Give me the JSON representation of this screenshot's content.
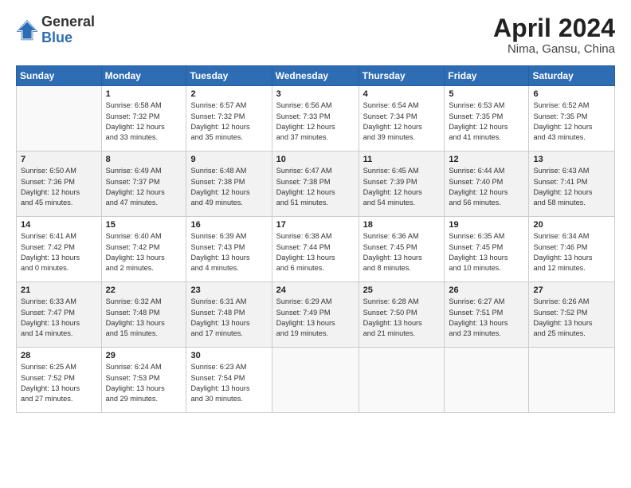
{
  "header": {
    "logo_general": "General",
    "logo_blue": "Blue",
    "month_title": "April 2024",
    "location": "Nima, Gansu, China"
  },
  "weekdays": [
    "Sunday",
    "Monday",
    "Tuesday",
    "Wednesday",
    "Thursday",
    "Friday",
    "Saturday"
  ],
  "weeks": [
    [
      {
        "day": "",
        "info": ""
      },
      {
        "day": "1",
        "info": "Sunrise: 6:58 AM\nSunset: 7:32 PM\nDaylight: 12 hours\nand 33 minutes."
      },
      {
        "day": "2",
        "info": "Sunrise: 6:57 AM\nSunset: 7:32 PM\nDaylight: 12 hours\nand 35 minutes."
      },
      {
        "day": "3",
        "info": "Sunrise: 6:56 AM\nSunset: 7:33 PM\nDaylight: 12 hours\nand 37 minutes."
      },
      {
        "day": "4",
        "info": "Sunrise: 6:54 AM\nSunset: 7:34 PM\nDaylight: 12 hours\nand 39 minutes."
      },
      {
        "day": "5",
        "info": "Sunrise: 6:53 AM\nSunset: 7:35 PM\nDaylight: 12 hours\nand 41 minutes."
      },
      {
        "day": "6",
        "info": "Sunrise: 6:52 AM\nSunset: 7:35 PM\nDaylight: 12 hours\nand 43 minutes."
      }
    ],
    [
      {
        "day": "7",
        "info": "Sunrise: 6:50 AM\nSunset: 7:36 PM\nDaylight: 12 hours\nand 45 minutes."
      },
      {
        "day": "8",
        "info": "Sunrise: 6:49 AM\nSunset: 7:37 PM\nDaylight: 12 hours\nand 47 minutes."
      },
      {
        "day": "9",
        "info": "Sunrise: 6:48 AM\nSunset: 7:38 PM\nDaylight: 12 hours\nand 49 minutes."
      },
      {
        "day": "10",
        "info": "Sunrise: 6:47 AM\nSunset: 7:38 PM\nDaylight: 12 hours\nand 51 minutes."
      },
      {
        "day": "11",
        "info": "Sunrise: 6:45 AM\nSunset: 7:39 PM\nDaylight: 12 hours\nand 54 minutes."
      },
      {
        "day": "12",
        "info": "Sunrise: 6:44 AM\nSunset: 7:40 PM\nDaylight: 12 hours\nand 56 minutes."
      },
      {
        "day": "13",
        "info": "Sunrise: 6:43 AM\nSunset: 7:41 PM\nDaylight: 12 hours\nand 58 minutes."
      }
    ],
    [
      {
        "day": "14",
        "info": "Sunrise: 6:41 AM\nSunset: 7:42 PM\nDaylight: 13 hours\nand 0 minutes."
      },
      {
        "day": "15",
        "info": "Sunrise: 6:40 AM\nSunset: 7:42 PM\nDaylight: 13 hours\nand 2 minutes."
      },
      {
        "day": "16",
        "info": "Sunrise: 6:39 AM\nSunset: 7:43 PM\nDaylight: 13 hours\nand 4 minutes."
      },
      {
        "day": "17",
        "info": "Sunrise: 6:38 AM\nSunset: 7:44 PM\nDaylight: 13 hours\nand 6 minutes."
      },
      {
        "day": "18",
        "info": "Sunrise: 6:36 AM\nSunset: 7:45 PM\nDaylight: 13 hours\nand 8 minutes."
      },
      {
        "day": "19",
        "info": "Sunrise: 6:35 AM\nSunset: 7:45 PM\nDaylight: 13 hours\nand 10 minutes."
      },
      {
        "day": "20",
        "info": "Sunrise: 6:34 AM\nSunset: 7:46 PM\nDaylight: 13 hours\nand 12 minutes."
      }
    ],
    [
      {
        "day": "21",
        "info": "Sunrise: 6:33 AM\nSunset: 7:47 PM\nDaylight: 13 hours\nand 14 minutes."
      },
      {
        "day": "22",
        "info": "Sunrise: 6:32 AM\nSunset: 7:48 PM\nDaylight: 13 hours\nand 15 minutes."
      },
      {
        "day": "23",
        "info": "Sunrise: 6:31 AM\nSunset: 7:48 PM\nDaylight: 13 hours\nand 17 minutes."
      },
      {
        "day": "24",
        "info": "Sunrise: 6:29 AM\nSunset: 7:49 PM\nDaylight: 13 hours\nand 19 minutes."
      },
      {
        "day": "25",
        "info": "Sunrise: 6:28 AM\nSunset: 7:50 PM\nDaylight: 13 hours\nand 21 minutes."
      },
      {
        "day": "26",
        "info": "Sunrise: 6:27 AM\nSunset: 7:51 PM\nDaylight: 13 hours\nand 23 minutes."
      },
      {
        "day": "27",
        "info": "Sunrise: 6:26 AM\nSunset: 7:52 PM\nDaylight: 13 hours\nand 25 minutes."
      }
    ],
    [
      {
        "day": "28",
        "info": "Sunrise: 6:25 AM\nSunset: 7:52 PM\nDaylight: 13 hours\nand 27 minutes."
      },
      {
        "day": "29",
        "info": "Sunrise: 6:24 AM\nSunset: 7:53 PM\nDaylight: 13 hours\nand 29 minutes."
      },
      {
        "day": "30",
        "info": "Sunrise: 6:23 AM\nSunset: 7:54 PM\nDaylight: 13 hours\nand 30 minutes."
      },
      {
        "day": "",
        "info": ""
      },
      {
        "day": "",
        "info": ""
      },
      {
        "day": "",
        "info": ""
      },
      {
        "day": "",
        "info": ""
      }
    ]
  ]
}
